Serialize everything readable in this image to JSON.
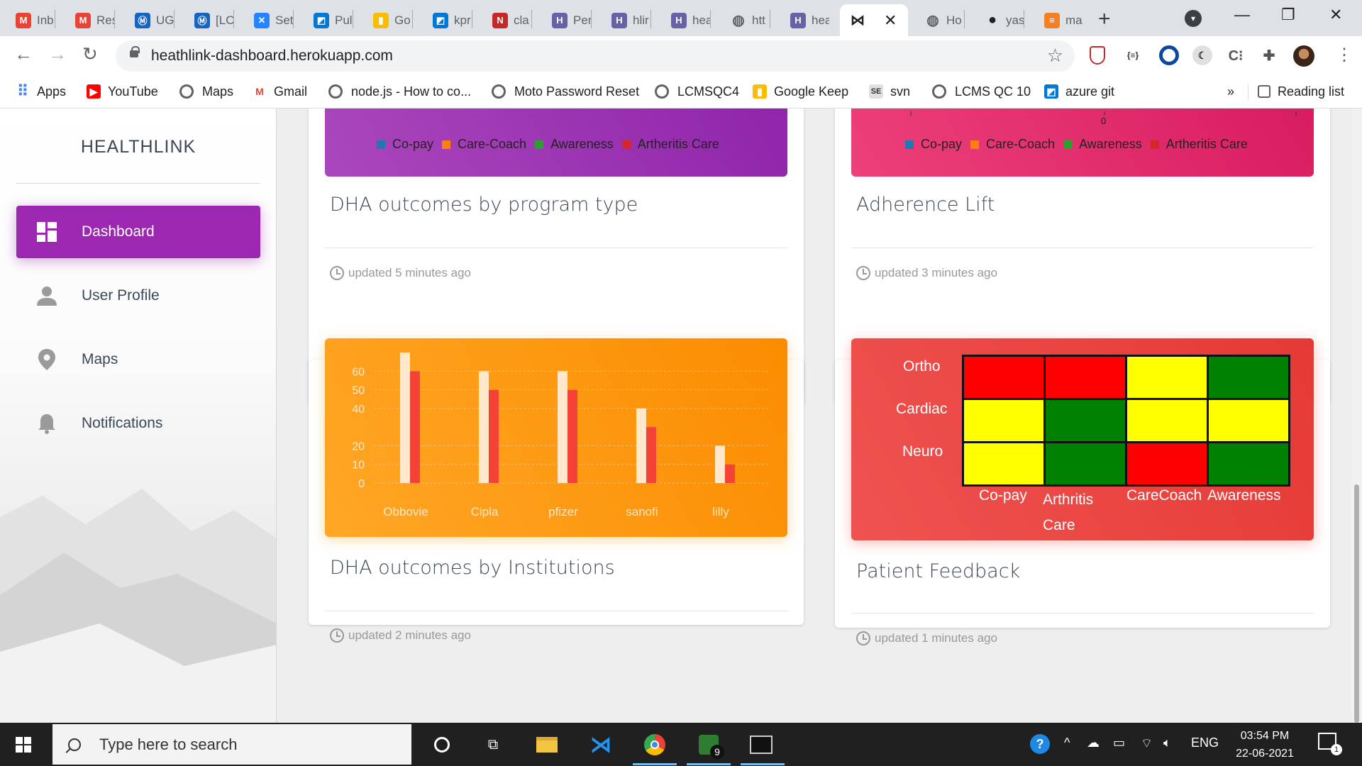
{
  "browser": {
    "tabs": [
      {
        "title": "Inb",
        "icon": "gmail",
        "color": "#ea4335"
      },
      {
        "title": "Res",
        "icon": "gmail",
        "color": "#ea4335"
      },
      {
        "title": "UG",
        "icon": "motorola",
        "color": "#1565c0"
      },
      {
        "title": "[LC",
        "icon": "motorola",
        "color": "#1565c0"
      },
      {
        "title": "Set",
        "icon": "confluence",
        "color": "#2684ff"
      },
      {
        "title": "Pul",
        "icon": "azure-devops",
        "color": "#0078d4"
      },
      {
        "title": "Go",
        "icon": "google-keep",
        "color": "#fbbc04"
      },
      {
        "title": "kpr",
        "icon": "azure-devops",
        "color": "#0078d4"
      },
      {
        "title": "cla",
        "icon": "n-logo",
        "color": "#c62828"
      },
      {
        "title": "Per",
        "icon": "heroku",
        "color": "#6762a6"
      },
      {
        "title": "hlir",
        "icon": "heroku",
        "color": "#6762a6"
      },
      {
        "title": "hea",
        "icon": "heroku",
        "color": "#6762a6"
      },
      {
        "title": "htt",
        "icon": "globe",
        "color": "#5f6368"
      },
      {
        "title": "hea",
        "icon": "heroku",
        "color": "#6762a6"
      },
      {
        "title": "",
        "icon": "bowtie",
        "color": "#202124",
        "active": true
      },
      {
        "title": "Ho",
        "icon": "globe",
        "color": "#5f6368"
      },
      {
        "title": "yas",
        "icon": "github",
        "color": "#202124"
      },
      {
        "title": "ma",
        "icon": "stackoverflow",
        "color": "#f48024"
      }
    ],
    "url": "heathlink-dashboard.herokuapp.com",
    "bookmarks": [
      {
        "label": "Apps",
        "icon": "apps-grid"
      },
      {
        "label": "YouTube",
        "icon": "youtube"
      },
      {
        "label": "Maps",
        "icon": "globe"
      },
      {
        "label": "Gmail",
        "icon": "gmail"
      },
      {
        "label": "node.js - How to co...",
        "icon": "globe"
      },
      {
        "label": "Moto Password Reset",
        "icon": "globe"
      },
      {
        "label": "LCMSQC4",
        "icon": "globe"
      },
      {
        "label": "Google Keep",
        "icon": "google-keep"
      },
      {
        "label": "svn",
        "icon": "se"
      },
      {
        "label": "LCMS QC 10",
        "icon": "globe"
      },
      {
        "label": "azure git",
        "icon": "azure-devops"
      }
    ],
    "bookmarks_more": "»",
    "reading_list": "Reading list"
  },
  "sidebar": {
    "brand": "HEALTHLINK",
    "items": [
      {
        "label": "Dashboard",
        "icon": "dashboard-icon",
        "active": true
      },
      {
        "label": "User Profile",
        "icon": "person-icon"
      },
      {
        "label": "Maps",
        "icon": "location-pin-icon"
      },
      {
        "label": "Notifications",
        "icon": "bell-icon"
      }
    ]
  },
  "cards": [
    {
      "title": "DHA outcomes by program type",
      "updated": "updated 5 minutes ago",
      "header_color": "#9c27b0",
      "legend": [
        {
          "label": "Co-pay",
          "color": "#1f77b4"
        },
        {
          "label": "Care-Coach",
          "color": "#ff7f0e"
        },
        {
          "label": "Awareness",
          "color": "#2ca02c"
        },
        {
          "label": "Artheritis Care",
          "color": "#d62728"
        }
      ]
    },
    {
      "title": "Adherence Lift",
      "updated": "updated 3 minutes ago",
      "header_color": "#e91e63",
      "axis_tick": "0",
      "legend": [
        {
          "label": "Co-pay",
          "color": "#1f77b4"
        },
        {
          "label": "Care-Coach",
          "color": "#ff7f0e"
        },
        {
          "label": "Awareness",
          "color": "#2ca02c"
        },
        {
          "label": "Artheritis Care",
          "color": "#d62728"
        }
      ]
    },
    {
      "title": "DHA outcomes by Institutions",
      "updated": "updated 2 minutes ago",
      "header_color": "#fb8c00"
    },
    {
      "title": "Patient Feedback",
      "updated": "updated 1 minutes ago",
      "header_color": "#e53935"
    }
  ],
  "chart_data": [
    {
      "type": "bar",
      "categories": [
        "Obbovie",
        "Cipla",
        "pfizer",
        "sanofi",
        "lilly"
      ],
      "series": [
        {
          "values": [
            70,
            60,
            60,
            40,
            20
          ],
          "color": "#ffe8cc"
        },
        {
          "values": [
            60,
            50,
            50,
            30,
            10
          ],
          "color": "#f44336"
        }
      ],
      "yticks": [
        0,
        10,
        20,
        40,
        50,
        60
      ],
      "ylim": [
        0,
        70
      ]
    },
    {
      "type": "heatmap",
      "rows": [
        "Ortho",
        "Cardiac",
        "Neuro"
      ],
      "columns": [
        "Co-pay",
        "Arthritis Care",
        "CareCoach",
        "Awareness"
      ],
      "cells": [
        [
          "red",
          "red",
          "yellow",
          "green"
        ],
        [
          "yellow",
          "green",
          "yellow",
          "yellow"
        ],
        [
          "yellow",
          "green",
          "red",
          "green"
        ]
      ],
      "colors": {
        "red": "#ff0000",
        "yellow": "#ffff00",
        "green": "#008000"
      }
    }
  ],
  "taskbar": {
    "search_placeholder": "Type here to search",
    "language": "ENG",
    "time": "03:54 PM",
    "date": "22-06-2021",
    "notification_count": "1",
    "teams_badge": "9"
  }
}
